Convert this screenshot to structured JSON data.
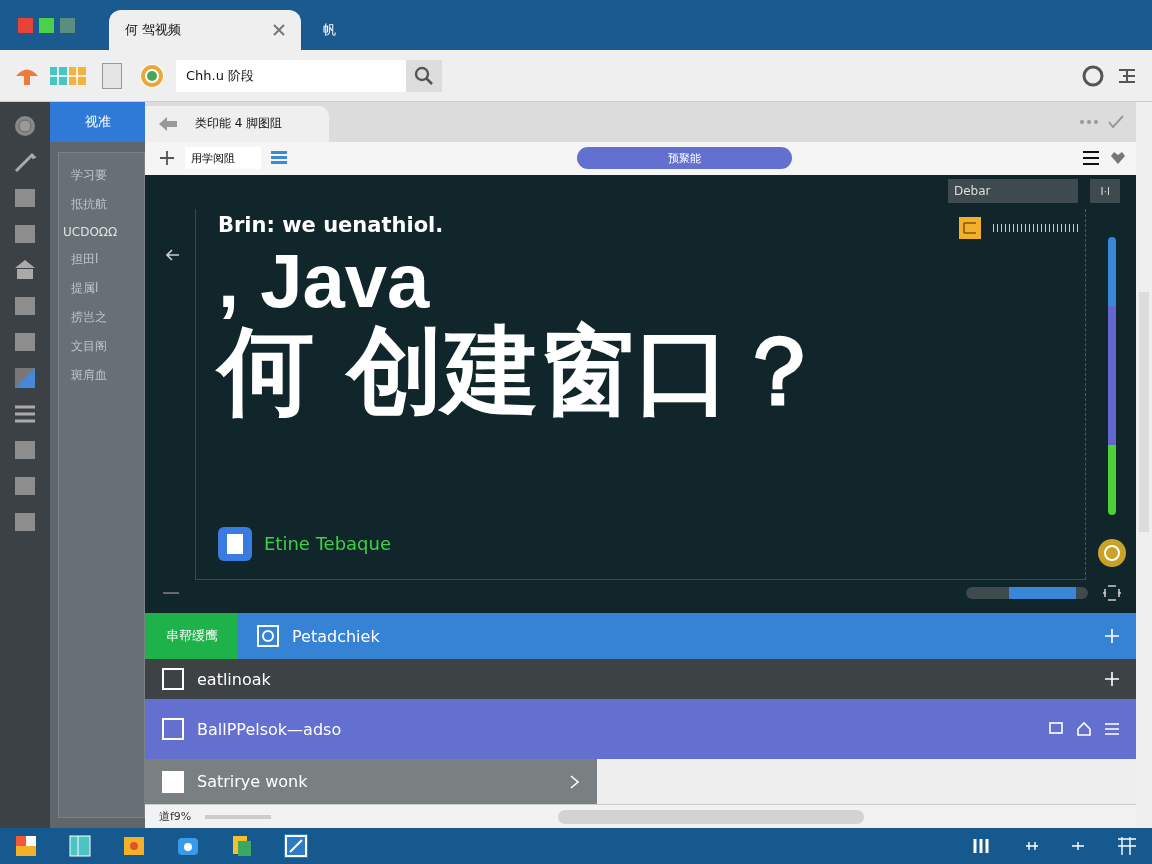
{
  "window": {
    "tabs": [
      {
        "label": "何 驾视频",
        "selected": true
      },
      {
        "label": "帆",
        "selected": false
      }
    ]
  },
  "toolbar": {
    "address": "Chh.u 阶段"
  },
  "sidebar": {
    "header": "视准",
    "items": [
      {
        "label": "学习要",
        "selected": false
      },
      {
        "label": "抵抗航",
        "selected": false
      },
      {
        "label": "UCDOΩΩ",
        "selected": true
      },
      {
        "label": "担田l",
        "selected": false
      },
      {
        "label": "提属l",
        "selected": false
      },
      {
        "label": "捞岂之",
        "selected": false
      },
      {
        "label": "文目阁",
        "selected": false
      },
      {
        "label": "斑肩血",
        "selected": false
      }
    ]
  },
  "content_tab": {
    "label": "类印能 4 脚图阻"
  },
  "content_toolbar": {
    "field": "用学阅阻",
    "pill": "预聚能"
  },
  "video": {
    "dropdown": "Debar",
    "button": "I·l",
    "subtitle": "Brin: we uenathiol.",
    "title_line_1": ", Java",
    "title_line_2": "何 创建窗口？",
    "caption": "Etine Tebaque"
  },
  "rows": [
    {
      "kind": "blue",
      "badge": "串帮缓鹰",
      "label": "Petadchiek"
    },
    {
      "kind": "dark",
      "label": "eatlinoak"
    },
    {
      "kind": "purple",
      "label": "BallPPelsok—adso"
    },
    {
      "kind": "gray",
      "label": "Satrirye wonk"
    }
  ],
  "status_bar": {
    "text": "道f9%"
  }
}
